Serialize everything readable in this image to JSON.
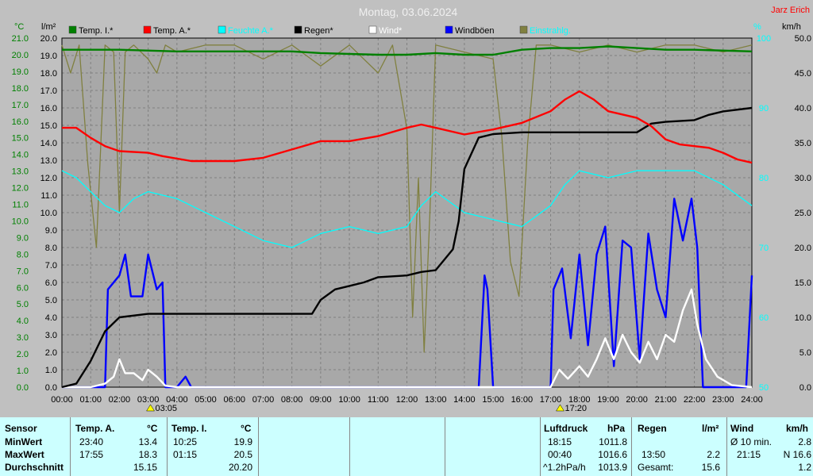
{
  "title": "Montag, 03.06.2024",
  "station": "Jarz Erich",
  "units": {
    "temp": "°C",
    "rain": "l/m²",
    "humidity": "%",
    "wind": "km/h"
  },
  "colors": {
    "temp_inside": "#008000",
    "temp_outside": "#ff0000",
    "humidity": "#00ffff",
    "rain": "#000000",
    "wind": "#ffffff",
    "gusts": "#0000ff",
    "radiation": "#808040",
    "grid": "#808080",
    "plot_bg": "#a8a8a8"
  },
  "legend": [
    {
      "label": "Temp. I.*",
      "color": "#008000"
    },
    {
      "label": "Temp. A.*",
      "color": "#ff0000"
    },
    {
      "label": "Feuchte A.*",
      "color": "#00ffff"
    },
    {
      "label": "Regen*",
      "color": "#000000"
    },
    {
      "label": "Wind*",
      "color": "#ffffff"
    },
    {
      "label": "Windböen",
      "color": "#0000ff"
    },
    {
      "label": "Einstrahlg.",
      "color": "#808040"
    }
  ],
  "event_markers": [
    {
      "label": "03:05",
      "x": 3.08
    },
    {
      "label": "17:20",
      "x": 17.33
    }
  ],
  "chart_data": {
    "type": "line",
    "x_label": "time (h)",
    "x_ticks": [
      "00:00",
      "01:00",
      "02:00",
      "03:00",
      "04:00",
      "05:00",
      "06:00",
      "07:00",
      "08:00",
      "09:00",
      "10:00",
      "11:00",
      "12:00",
      "13:00",
      "14:00",
      "15:00",
      "16:00",
      "17:00",
      "18:00",
      "19:00",
      "20:00",
      "21:00",
      "22:00",
      "23:00",
      "24:00"
    ],
    "xlim": [
      0,
      24
    ],
    "axes": {
      "temp": {
        "ylim": [
          0,
          21
        ],
        "ticks": [
          0,
          1,
          2,
          3,
          4,
          5,
          6,
          7,
          8,
          9,
          10,
          11,
          12,
          13,
          14,
          15,
          16,
          17,
          18,
          19,
          20,
          21
        ]
      },
      "rain": {
        "ylim": [
          0,
          20
        ],
        "ticks": [
          0,
          1,
          2,
          3,
          4,
          5,
          6,
          7,
          8,
          9,
          10,
          11,
          12,
          13,
          14,
          15,
          16,
          17,
          18,
          19,
          20
        ]
      },
      "humidity": {
        "ylim": [
          50,
          100
        ],
        "ticks": [
          50,
          60,
          70,
          80,
          90,
          100
        ]
      },
      "wind": {
        "ylim": [
          0,
          50
        ],
        "ticks": [
          0,
          5,
          10,
          15,
          20,
          25,
          30,
          35,
          40,
          45,
          50
        ]
      }
    },
    "grid": true,
    "legend_position": "top",
    "series": [
      {
        "name": "Temp. I.*",
        "axis": "temp",
        "color": "#008000",
        "points": [
          [
            0,
            20.3
          ],
          [
            2,
            20.3
          ],
          [
            4,
            20.2
          ],
          [
            6,
            20.2
          ],
          [
            8,
            20.2
          ],
          [
            9,
            20.1
          ],
          [
            11,
            20.0
          ],
          [
            12,
            20.0
          ],
          [
            13,
            20.1
          ],
          [
            14,
            20.0
          ],
          [
            15,
            20.0
          ],
          [
            16,
            20.3
          ],
          [
            17,
            20.4
          ],
          [
            18,
            20.4
          ],
          [
            19,
            20.5
          ],
          [
            20,
            20.4
          ],
          [
            21,
            20.3
          ],
          [
            22,
            20.3
          ],
          [
            24,
            20.2
          ]
        ]
      },
      {
        "name": "Temp. A.*",
        "axis": "temp",
        "color": "#ff0000",
        "points": [
          [
            0,
            15.6
          ],
          [
            0.5,
            15.6
          ],
          [
            1,
            15.0
          ],
          [
            1.5,
            14.5
          ],
          [
            2,
            14.2
          ],
          [
            3,
            14.1
          ],
          [
            3.5,
            13.9
          ],
          [
            4.5,
            13.6
          ],
          [
            5,
            13.6
          ],
          [
            6,
            13.6
          ],
          [
            7,
            13.8
          ],
          [
            8,
            14.3
          ],
          [
            9,
            14.8
          ],
          [
            10,
            14.8
          ],
          [
            11,
            15.1
          ],
          [
            12,
            15.6
          ],
          [
            12.5,
            15.8
          ],
          [
            13,
            15.6
          ],
          [
            14,
            15.2
          ],
          [
            15,
            15.5
          ],
          [
            16,
            15.9
          ],
          [
            17,
            16.6
          ],
          [
            17.5,
            17.3
          ],
          [
            18,
            17.8
          ],
          [
            18.5,
            17.3
          ],
          [
            19,
            16.6
          ],
          [
            20,
            16.2
          ],
          [
            20.5,
            15.7
          ],
          [
            21,
            14.9
          ],
          [
            21.5,
            14.6
          ],
          [
            22,
            14.5
          ],
          [
            22.5,
            14.4
          ],
          [
            23,
            14.1
          ],
          [
            23.5,
            13.7
          ],
          [
            24,
            13.5
          ]
        ]
      },
      {
        "name": "Feuchte A.*",
        "axis": "humidity",
        "color": "#00ffff",
        "points": [
          [
            0,
            81
          ],
          [
            0.5,
            80
          ],
          [
            1,
            78
          ],
          [
            1.5,
            76
          ],
          [
            2,
            75
          ],
          [
            2.5,
            77
          ],
          [
            3,
            78
          ],
          [
            4,
            77
          ],
          [
            5,
            75
          ],
          [
            6,
            73
          ],
          [
            7,
            71
          ],
          [
            8,
            70
          ],
          [
            9,
            72
          ],
          [
            10,
            73
          ],
          [
            11,
            72
          ],
          [
            12,
            73
          ],
          [
            12.5,
            76
          ],
          [
            13,
            78
          ],
          [
            14,
            75
          ],
          [
            15,
            74
          ],
          [
            16,
            73
          ],
          [
            17,
            76
          ],
          [
            17.5,
            79
          ],
          [
            18,
            81
          ],
          [
            19,
            80
          ],
          [
            20,
            81
          ],
          [
            21,
            81
          ],
          [
            22,
            81
          ],
          [
            23,
            79
          ],
          [
            24,
            76
          ]
        ]
      },
      {
        "name": "Regen*",
        "axis": "rain",
        "color": "#000000",
        "points": [
          [
            0,
            0
          ],
          [
            0.5,
            0.2
          ],
          [
            1,
            1.5
          ],
          [
            1.5,
            3.2
          ],
          [
            2,
            4.0
          ],
          [
            3,
            4.2
          ],
          [
            5,
            4.2
          ],
          [
            7,
            4.2
          ],
          [
            8.7,
            4.2
          ],
          [
            9,
            5.0
          ],
          [
            9.5,
            5.6
          ],
          [
            10,
            5.8
          ],
          [
            10.5,
            6.0
          ],
          [
            11,
            6.3
          ],
          [
            12,
            6.4
          ],
          [
            12.5,
            6.6
          ],
          [
            13,
            6.7
          ],
          [
            13.3,
            7.3
          ],
          [
            13.6,
            7.9
          ],
          [
            13.8,
            9.5
          ],
          [
            14,
            12.5
          ],
          [
            14.5,
            14.3
          ],
          [
            15,
            14.5
          ],
          [
            16,
            14.6
          ],
          [
            17,
            14.6
          ],
          [
            18,
            14.6
          ],
          [
            19,
            14.6
          ],
          [
            20,
            14.6
          ],
          [
            20.5,
            15.1
          ],
          [
            21,
            15.2
          ],
          [
            22,
            15.3
          ],
          [
            22.5,
            15.6
          ],
          [
            23,
            15.8
          ],
          [
            24,
            16.0
          ]
        ]
      },
      {
        "name": "Wind*",
        "axis": "wind",
        "color": "#ffffff",
        "points": [
          [
            0,
            0
          ],
          [
            1,
            0
          ],
          [
            1.5,
            0.5
          ],
          [
            1.8,
            1.5
          ],
          [
            2,
            4
          ],
          [
            2.2,
            2
          ],
          [
            2.5,
            2
          ],
          [
            2.8,
            1.0
          ],
          [
            3,
            2.5
          ],
          [
            3.3,
            1.5
          ],
          [
            3.6,
            0.2
          ],
          [
            4,
            0
          ],
          [
            17,
            0
          ],
          [
            17.3,
            2.5
          ],
          [
            17.6,
            1.2
          ],
          [
            18,
            3
          ],
          [
            18.3,
            1.5
          ],
          [
            18.6,
            4
          ],
          [
            18.9,
            7
          ],
          [
            19.2,
            4
          ],
          [
            19.5,
            7.5
          ],
          [
            19.8,
            5
          ],
          [
            20.1,
            3.5
          ],
          [
            20.4,
            6.5
          ],
          [
            20.7,
            4
          ],
          [
            21,
            7.5
          ],
          [
            21.3,
            6.5
          ],
          [
            21.6,
            11
          ],
          [
            21.9,
            14
          ],
          [
            22.1,
            9
          ],
          [
            22.4,
            4
          ],
          [
            22.8,
            1.5
          ],
          [
            23.3,
            0.3
          ],
          [
            24,
            0
          ]
        ]
      },
      {
        "name": "Windböen",
        "axis": "wind",
        "color": "#0000ff",
        "points": [
          [
            0,
            0
          ],
          [
            1.5,
            0
          ],
          [
            1.6,
            14
          ],
          [
            2,
            16
          ],
          [
            2.2,
            19
          ],
          [
            2.4,
            13
          ],
          [
            2.8,
            13
          ],
          [
            3,
            19
          ],
          [
            3.3,
            14
          ],
          [
            3.5,
            15
          ],
          [
            3.6,
            0
          ],
          [
            4,
            0
          ],
          [
            4.3,
            1.5
          ],
          [
            4.5,
            0
          ],
          [
            14.5,
            0
          ],
          [
            14.7,
            16
          ],
          [
            14.8,
            14
          ],
          [
            15,
            0
          ],
          [
            17,
            0
          ],
          [
            17.1,
            14
          ],
          [
            17.4,
            17
          ],
          [
            17.7,
            7
          ],
          [
            18,
            19
          ],
          [
            18.3,
            6
          ],
          [
            18.6,
            19
          ],
          [
            18.9,
            23
          ],
          [
            19.2,
            3
          ],
          [
            19.5,
            21
          ],
          [
            19.8,
            20
          ],
          [
            20.1,
            4
          ],
          [
            20.4,
            22
          ],
          [
            20.7,
            14
          ],
          [
            21,
            10
          ],
          [
            21.3,
            27
          ],
          [
            21.6,
            21
          ],
          [
            21.9,
            27
          ],
          [
            22.1,
            20
          ],
          [
            22.3,
            0
          ],
          [
            23.8,
            0
          ],
          [
            24,
            16
          ]
        ]
      },
      {
        "name": "Einstrahlg.",
        "axis": "humidity",
        "color": "#808040",
        "points": [
          [
            0,
            99
          ],
          [
            0.3,
            95
          ],
          [
            0.6,
            99
          ],
          [
            0.9,
            82
          ],
          [
            1.2,
            70
          ],
          [
            1.5,
            99
          ],
          [
            1.8,
            98
          ],
          [
            2,
            75
          ],
          [
            2.2,
            98
          ],
          [
            2.5,
            99
          ],
          [
            3,
            97
          ],
          [
            3.3,
            95
          ],
          [
            3.6,
            99
          ],
          [
            4,
            98
          ],
          [
            5,
            99
          ],
          [
            6,
            99
          ],
          [
            7,
            97
          ],
          [
            8,
            99
          ],
          [
            9,
            96
          ],
          [
            10,
            99
          ],
          [
            11,
            95
          ],
          [
            11.5,
            99
          ],
          [
            12,
            87
          ],
          [
            12.2,
            60
          ],
          [
            12.4,
            80
          ],
          [
            12.6,
            55
          ],
          [
            12.8,
            75
          ],
          [
            13,
            99
          ],
          [
            14,
            98
          ],
          [
            15,
            97
          ],
          [
            15.3,
            86
          ],
          [
            15.6,
            68
          ],
          [
            15.9,
            63
          ],
          [
            16.2,
            85
          ],
          [
            16.5,
            99
          ],
          [
            17,
            99
          ],
          [
            18,
            98
          ],
          [
            19,
            99
          ],
          [
            20,
            98
          ],
          [
            21,
            99
          ],
          [
            22,
            99
          ],
          [
            23,
            98
          ],
          [
            24,
            99
          ]
        ]
      }
    ]
  },
  "stats": {
    "headers": {
      "sensor": "Sensor",
      "temp_a": "Temp. A.",
      "temp_a_unit": "°C",
      "temp_i": "Temp. I.",
      "temp_i_unit": "°C",
      "pressure": "Luftdruck",
      "pressure_unit": "hPa",
      "rain": "Regen",
      "rain_unit": "l/m²",
      "wind": "Wind",
      "wind_unit": "km/h"
    },
    "rows": [
      {
        "label": "MinWert",
        "temp_a_time": "23:40",
        "temp_a_val": "13.4",
        "temp_i_time": "10:25",
        "temp_i_val": "19.9",
        "press_time": "18:15",
        "press_val": "1011.8",
        "rain_time": "",
        "rain_val": "",
        "wind_label": "Ø 10 min.",
        "wind_val": "2.8"
      },
      {
        "label": "MaxWert",
        "temp_a_time": "17:55",
        "temp_a_val": "18.3",
        "temp_i_time": "01:15",
        "temp_i_val": "20.5",
        "press_time": "00:40",
        "press_val": "1016.6",
        "rain_time": "13:50",
        "rain_val": "2.2",
        "wind_label": "21:15",
        "wind_val": "N 16.6"
      },
      {
        "label": "Durchschnitt",
        "temp_a_time": "",
        "temp_a_val": "15.15",
        "temp_i_time": "",
        "temp_i_val": "20.20",
        "press_time": "^1.2hPa/h",
        "press_val": "1013.9",
        "rain_time": "Gesamt:",
        "rain_val": "15.6",
        "wind_label": "",
        "wind_val": "1.2"
      }
    ]
  }
}
